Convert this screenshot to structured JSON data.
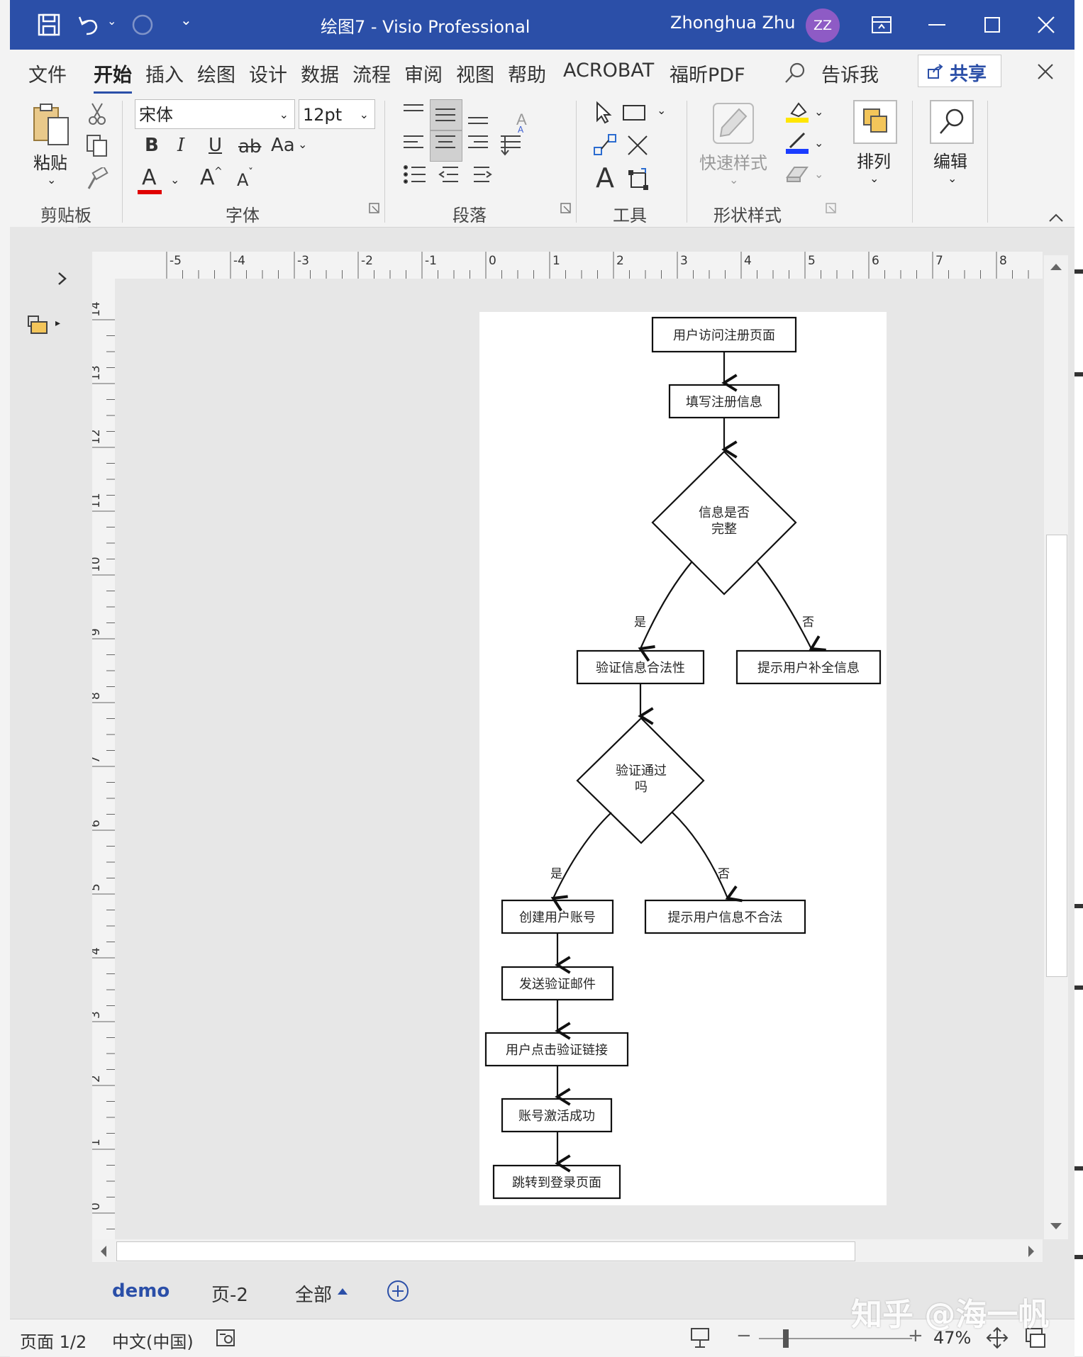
{
  "window": {
    "title": "绘图7  -  Visio Professional",
    "user_name": "Zhonghua Zhu",
    "user_initials": "ZZ",
    "accent_color": "#2b4fa8",
    "avatar_color": "#8e5bc5"
  },
  "menu": {
    "items": [
      "文件",
      "开始",
      "插入",
      "绘图",
      "设计",
      "数据",
      "流程",
      "审阅",
      "视图",
      "帮助",
      "ACROBAT",
      "福昕PDF"
    ],
    "active": "开始",
    "tell_me": "告诉我",
    "share": "共享"
  },
  "ribbon": {
    "clipboard": {
      "paste": "粘贴",
      "label": "剪贴板"
    },
    "font": {
      "family": "宋体",
      "size": "12pt",
      "label": "字体",
      "bold": "B",
      "italic": "I",
      "underline": "U",
      "strike": "ab",
      "case": "Aa",
      "color_letter": "A",
      "grow": "A",
      "shrink": "A",
      "font_color": "#e00000"
    },
    "paragraph": {
      "label": "段落"
    },
    "tools": {
      "label": "工具",
      "text": "A"
    },
    "shape_styles": {
      "quick_styles": "快速样式",
      "label": "形状样式",
      "fill_color": "#ffe600",
      "line_color": "#1a3cff"
    },
    "arrange": {
      "label": "排列"
    },
    "edit": {
      "label": "编辑"
    }
  },
  "rulers": {
    "horizontal": [
      "-5",
      "-4",
      "-3",
      "-2",
      "-1",
      "0",
      "1",
      "2",
      "3",
      "4",
      "5",
      "6",
      "7",
      "8"
    ],
    "vertical": [
      "14",
      "13",
      "12",
      "11",
      "10",
      "9",
      "8",
      "7",
      "6",
      "5",
      "4",
      "3",
      "2",
      "1",
      "0"
    ]
  },
  "flowchart": {
    "nodes": {
      "visit": "用户访问注册页面",
      "fill": "填写注册信息",
      "complete_q_line1": "信息是否",
      "complete_q_line2": "完整",
      "validate": "验证信息合法性",
      "prompt_complete": "提示用户补全信息",
      "pass_q_line1": "验证通过",
      "pass_q_line2": "吗",
      "create": "创建用户账号",
      "prompt_invalid": "提示用户信息不合法",
      "send_mail": "发送验证邮件",
      "click_link": "用户点击验证链接",
      "activated": "账号激活成功",
      "redirect": "跳转到登录页面"
    },
    "edge_labels": {
      "yes1": "是",
      "no1": "否",
      "yes2": "是",
      "no2": "否"
    }
  },
  "tabs": {
    "items": [
      "demo",
      "页-2",
      "全部"
    ],
    "active": "demo"
  },
  "status": {
    "page": "页面 1/2",
    "language": "中文(中国)",
    "zoom": "47%"
  },
  "watermark": "知乎 @海一帆"
}
